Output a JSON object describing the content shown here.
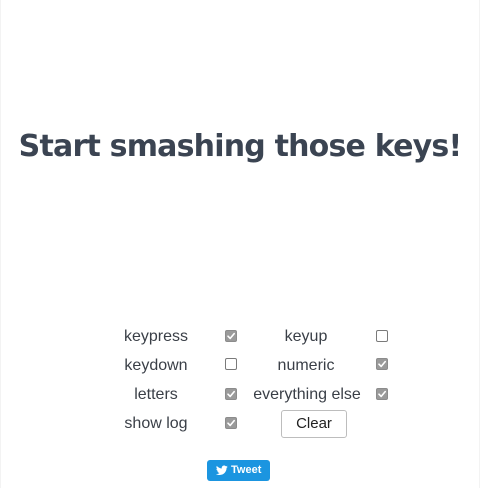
{
  "headline": "Start smashing those keys!",
  "options": {
    "keypress": {
      "label": "keypress",
      "checked": true
    },
    "keyup": {
      "label": "keyup",
      "checked": false
    },
    "keydown": {
      "label": "keydown",
      "checked": false
    },
    "numeric": {
      "label": "numeric",
      "checked": true
    },
    "letters": {
      "label": "letters",
      "checked": true
    },
    "everything_else": {
      "label": "everything else",
      "checked": true
    },
    "show_log": {
      "label": "show log",
      "checked": true
    }
  },
  "buttons": {
    "clear_label": "Clear",
    "tweet_label": "Tweet"
  },
  "icons": {
    "tweet": "twitter-bird-icon",
    "check": "checkmark-icon"
  },
  "colors": {
    "title": "#3b4452",
    "tweet_bg": "#1b95e0",
    "checkbox_on": "#9a9a9a"
  }
}
